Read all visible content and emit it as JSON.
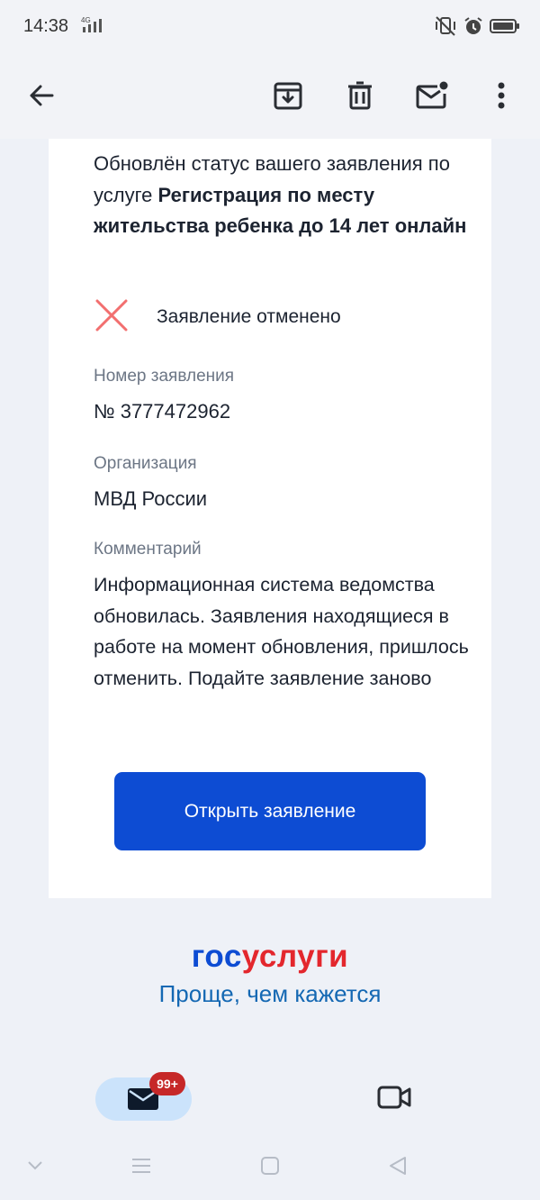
{
  "status_bar": {
    "time": "14:38",
    "network": "4G"
  },
  "toolbar": {
    "back_icon": "arrow-left-icon",
    "archive_icon": "archive-download-icon",
    "delete_icon": "trash-icon",
    "unread_icon": "mail-unread-icon",
    "more_icon": "more-vertical-icon"
  },
  "message": {
    "intro_prefix": "Обновлён статус вашего заявления по услуге ",
    "service_name": "Регистрация по месту жительства ребенка до 14 лет онлайн",
    "status_text": "Заявление отменено",
    "number_label": "Номер заявления",
    "number_value": "№ 3777472962",
    "org_label": "Организация",
    "org_value": "МВД России",
    "comment_label": "Комментарий",
    "comment_value": "Информационная система ведомства обновилась. Заявления находящиеся в работе на момент обновления, пришлось отменить. Подайте заявление заново",
    "open_button": "Открыть заявление"
  },
  "brand": {
    "logo_part1": "гос",
    "logo_part2": "услуги",
    "slogan": "Проще, чем кажется"
  },
  "bottom_nav": {
    "mail_badge": "99+"
  },
  "colors": {
    "accent": "#0d4cd3",
    "error": "#f26f6f",
    "badge": "#c62828"
  }
}
